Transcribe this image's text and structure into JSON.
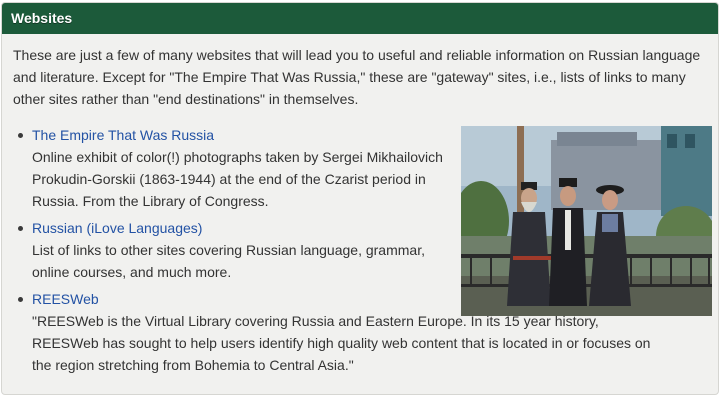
{
  "header": {
    "title": "Websites"
  },
  "intro": "These are just a few of many websites that will lead you to useful and reliable information on Russian language and literature. Except for \"The Empire That Was Russia,\" these are \"gateway\" sites, i.e., lists of links to many other sites rather than \"end destinations\" in themselves.",
  "links": [
    {
      "title": "The Empire That Was Russia",
      "description": "Online exhibit of color(!) photographs taken by Sergei Mikhailovich Prokudin-Gorskii (1863-1944) at the end of the Czarist period in Russia. From the Library of Congress."
    },
    {
      "title": "Russian (iLove Languages)",
      "description": "List of links to other sites covering Russian language, grammar, online courses, and much more."
    },
    {
      "title": "REESWeb",
      "description": "\"REESWeb is the Virtual Library covering Russia and Eastern Europe. In its 15 year history, REESWeb has sought to help users identify high quality web content that is located in or focuses on the region stretching from Bohemia to Central Asia.\""
    }
  ],
  "colors": {
    "header_bg": "#1c5a3a",
    "panel_bg": "#f1f1ef",
    "link": "#2352a4",
    "text": "#333333"
  },
  "photo": {
    "icon": "photograph-three-people-icon"
  }
}
